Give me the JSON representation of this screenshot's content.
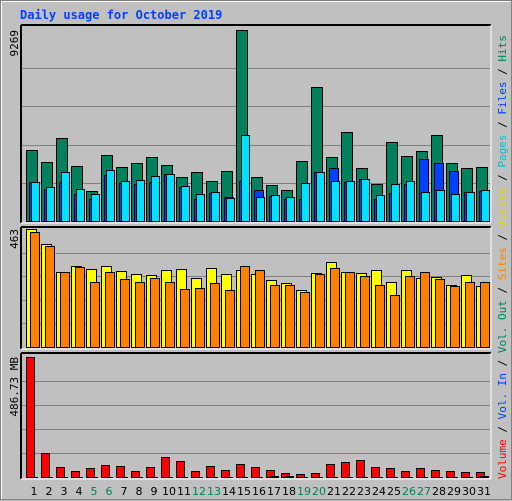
{
  "chart_data": {
    "type": "bar",
    "title": "Daily usage for October 2019",
    "categories": [
      "1",
      "2",
      "3",
      "4",
      "5",
      "6",
      "7",
      "8",
      "9",
      "10",
      "11",
      "12",
      "13",
      "14",
      "15",
      "16",
      "17",
      "18",
      "19",
      "20",
      "21",
      "22",
      "23",
      "24",
      "25",
      "26",
      "27",
      "28",
      "29",
      "30",
      "31"
    ],
    "weekend_days": [
      "5",
      "6",
      "12",
      "13",
      "19",
      "20",
      "26",
      "27"
    ],
    "panels": [
      {
        "name": "hits-files-pages",
        "ymax_label": "9269",
        "ylim": [
          0,
          9269
        ],
        "series": [
          {
            "name": "Hits",
            "color": "#00805c",
            "values": [
              3445,
              2863,
              4028,
              2669,
              1456,
              3203,
              2620,
              2815,
              3106,
              2718,
              2135,
              2378,
              1941,
              2427,
              9269,
              2135,
              1747,
              1504,
              2912,
              6503,
              3106,
              4319,
              2572,
              1796,
              3834,
              3154,
              3397,
              4173,
              2815,
              2572,
              2620
            ]
          },
          {
            "name": "Files",
            "color": "#0040ff",
            "values": [
              1890,
              1550,
              1890,
              1320,
              1060,
              2230,
              1860,
              1780,
              1890,
              2280,
              1670,
              1080,
              1340,
              1150,
              1930,
              1520,
              1230,
              1080,
              1090,
              2400,
              2590,
              1890,
              2060,
              1090,
              1340,
              1780,
              3010,
              2830,
              2420,
              1400,
              1450
            ]
          },
          {
            "name": "Pages",
            "color": "#00e0ff",
            "values": [
              1900,
              1650,
              2360,
              1550,
              1300,
              2470,
              1950,
              2000,
              2200,
              2290,
              1680,
              1290,
              1400,
              1140,
              4170,
              1150,
              1250,
              1160,
              1850,
              2380,
              1950,
              1950,
              2040,
              1240,
              1810,
              1930,
              1400,
              1500,
              1330,
              1400,
              1500
            ]
          }
        ]
      },
      {
        "name": "visits-sites",
        "ymax_label": "463",
        "ylim": [
          0,
          463
        ],
        "series": [
          {
            "name": "Visits",
            "color": "#ffff00",
            "values": [
              463,
              405,
              293,
              319,
              308,
              318,
              297,
              288,
              284,
              302,
              307,
              271,
              311,
              287,
              303,
              287,
              261,
              250,
              224,
              292,
              335,
              296,
              292,
              304,
              256,
              304,
              271,
              274,
              242,
              282,
              238
            ]
          },
          {
            "name": "Sites",
            "color": "#ff8000",
            "values": [
              450,
              398,
              293,
              312,
              254,
              294,
              266,
              255,
              271,
              255,
              227,
              230,
              250,
              224,
              316,
              302,
              244,
              244,
              216,
              286,
              309,
              296,
              278,
              244,
              205,
              280,
              295,
              265,
              238,
              254,
              256
            ]
          }
        ]
      },
      {
        "name": "volume",
        "ymax_label": "486.73 MB",
        "ylim": [
          0,
          486.73
        ],
        "series": [
          {
            "name": "Volume",
            "color": "#ff0000",
            "values": [
              486.73,
              97,
              42,
              23,
              38,
              48,
              45,
              25,
              40,
              80,
              63,
              26,
              44,
              28,
              52,
              40,
              28,
              16,
              12,
              16,
              53,
              61,
              67,
              41,
              37,
              25,
              38,
              30,
              25,
              21,
              21
            ]
          },
          {
            "name": "Vol. In",
            "color": "#0040ff",
            "values": [
              0,
              0,
              0,
              0,
              0,
              0,
              0,
              0,
              0,
              0,
              0,
              0,
              0,
              0,
              0,
              2,
              3,
              3,
              0,
              0,
              0,
              0,
              0,
              0,
              0,
              0,
              0,
              0,
              0,
              0,
              3
            ]
          },
          {
            "name": "Vol. Out",
            "color": "#00805c",
            "values": [
              0,
              0,
              0,
              0,
              0,
              0,
              0,
              0,
              0,
              0,
              0,
              0,
              0,
              0,
              0,
              0,
              0,
              0,
              0,
              0,
              0,
              0,
              0,
              0,
              0,
              0,
              0,
              0,
              0,
              0,
              0
            ]
          }
        ]
      }
    ],
    "legend_right": [
      {
        "label": "Volume",
        "color": "#ff0000"
      },
      {
        "label": "Vol. In",
        "color": "#0040ff"
      },
      {
        "label": "Vol. Out",
        "color": "#00805c"
      },
      {
        "label": "Sites",
        "color": "#ff8000"
      },
      {
        "label": "Visits",
        "color": "#e0e000"
      },
      {
        "label": "Pages",
        "color": "#00c0d0"
      },
      {
        "label": "Files",
        "color": "#0040ff"
      },
      {
        "label": "Hits",
        "color": "#00805c"
      }
    ],
    "legend_separator": "/",
    "legend_placement": "right",
    "grid": true,
    "xlabel": "",
    "ylabel": ""
  }
}
